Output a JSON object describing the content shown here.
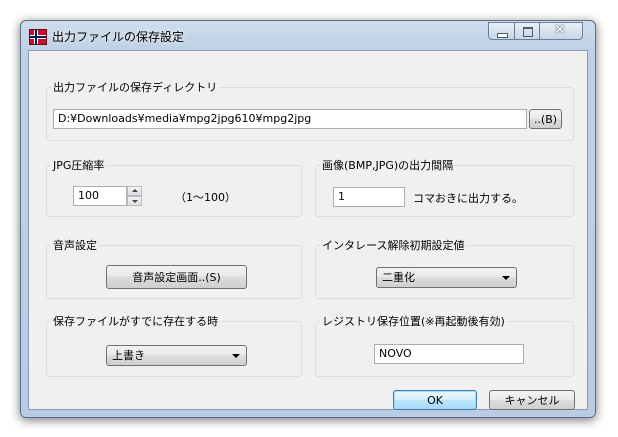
{
  "window": {
    "title": "出力ファイルの保存設定",
    "controls": {
      "minimize": "minimize",
      "maximize": "maximize",
      "close": "close"
    }
  },
  "output_directory": {
    "legend": "出力ファイルの保存ディレクトリ",
    "path": "D:¥Downloads¥media¥mpg2jpg610¥mpg2jpg",
    "browse_label": "..(B)"
  },
  "jpg_compression": {
    "legend": "JPG圧縮率",
    "value": "100",
    "range_note": "（1〜100）"
  },
  "image_interval": {
    "legend": "画像(BMP,JPG)の出力間隔",
    "value": "1",
    "suffix": "コマおきに出力する。"
  },
  "audio": {
    "legend": "音声設定",
    "button_label": "音声設定画面..(S)"
  },
  "deinterlace": {
    "legend": "インタレース解除初期設定値",
    "selected": "二重化"
  },
  "file_exists": {
    "legend": "保存ファイルがすでに存在する時",
    "selected": "上書き"
  },
  "registry": {
    "legend": "レジストリ保存位置(※再起動後有効)",
    "value": "NOVO"
  },
  "footer": {
    "ok_label": "OK",
    "cancel_label": "キャンセル"
  }
}
